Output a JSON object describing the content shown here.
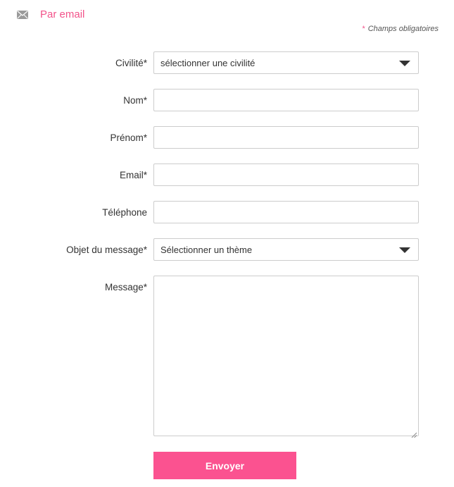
{
  "header": {
    "title": "Par email",
    "icon": "mail-icon"
  },
  "required_note": {
    "star": "*",
    "text": "Champs obligatoires"
  },
  "form": {
    "civilite": {
      "label": "Civilité*",
      "value": "sélectionner une civilité"
    },
    "nom": {
      "label": "Nom*",
      "value": ""
    },
    "prenom": {
      "label": "Prénom*",
      "value": ""
    },
    "email": {
      "label": "Email*",
      "value": ""
    },
    "telephone": {
      "label": "Téléphone",
      "value": ""
    },
    "objet": {
      "label": "Objet du message*",
      "value": "Sélectionner un thème"
    },
    "message": {
      "label": "Message*",
      "value": ""
    },
    "submit_label": "Envoyer"
  },
  "colors": {
    "accent": "#f2538a",
    "button": "#fb5290"
  }
}
